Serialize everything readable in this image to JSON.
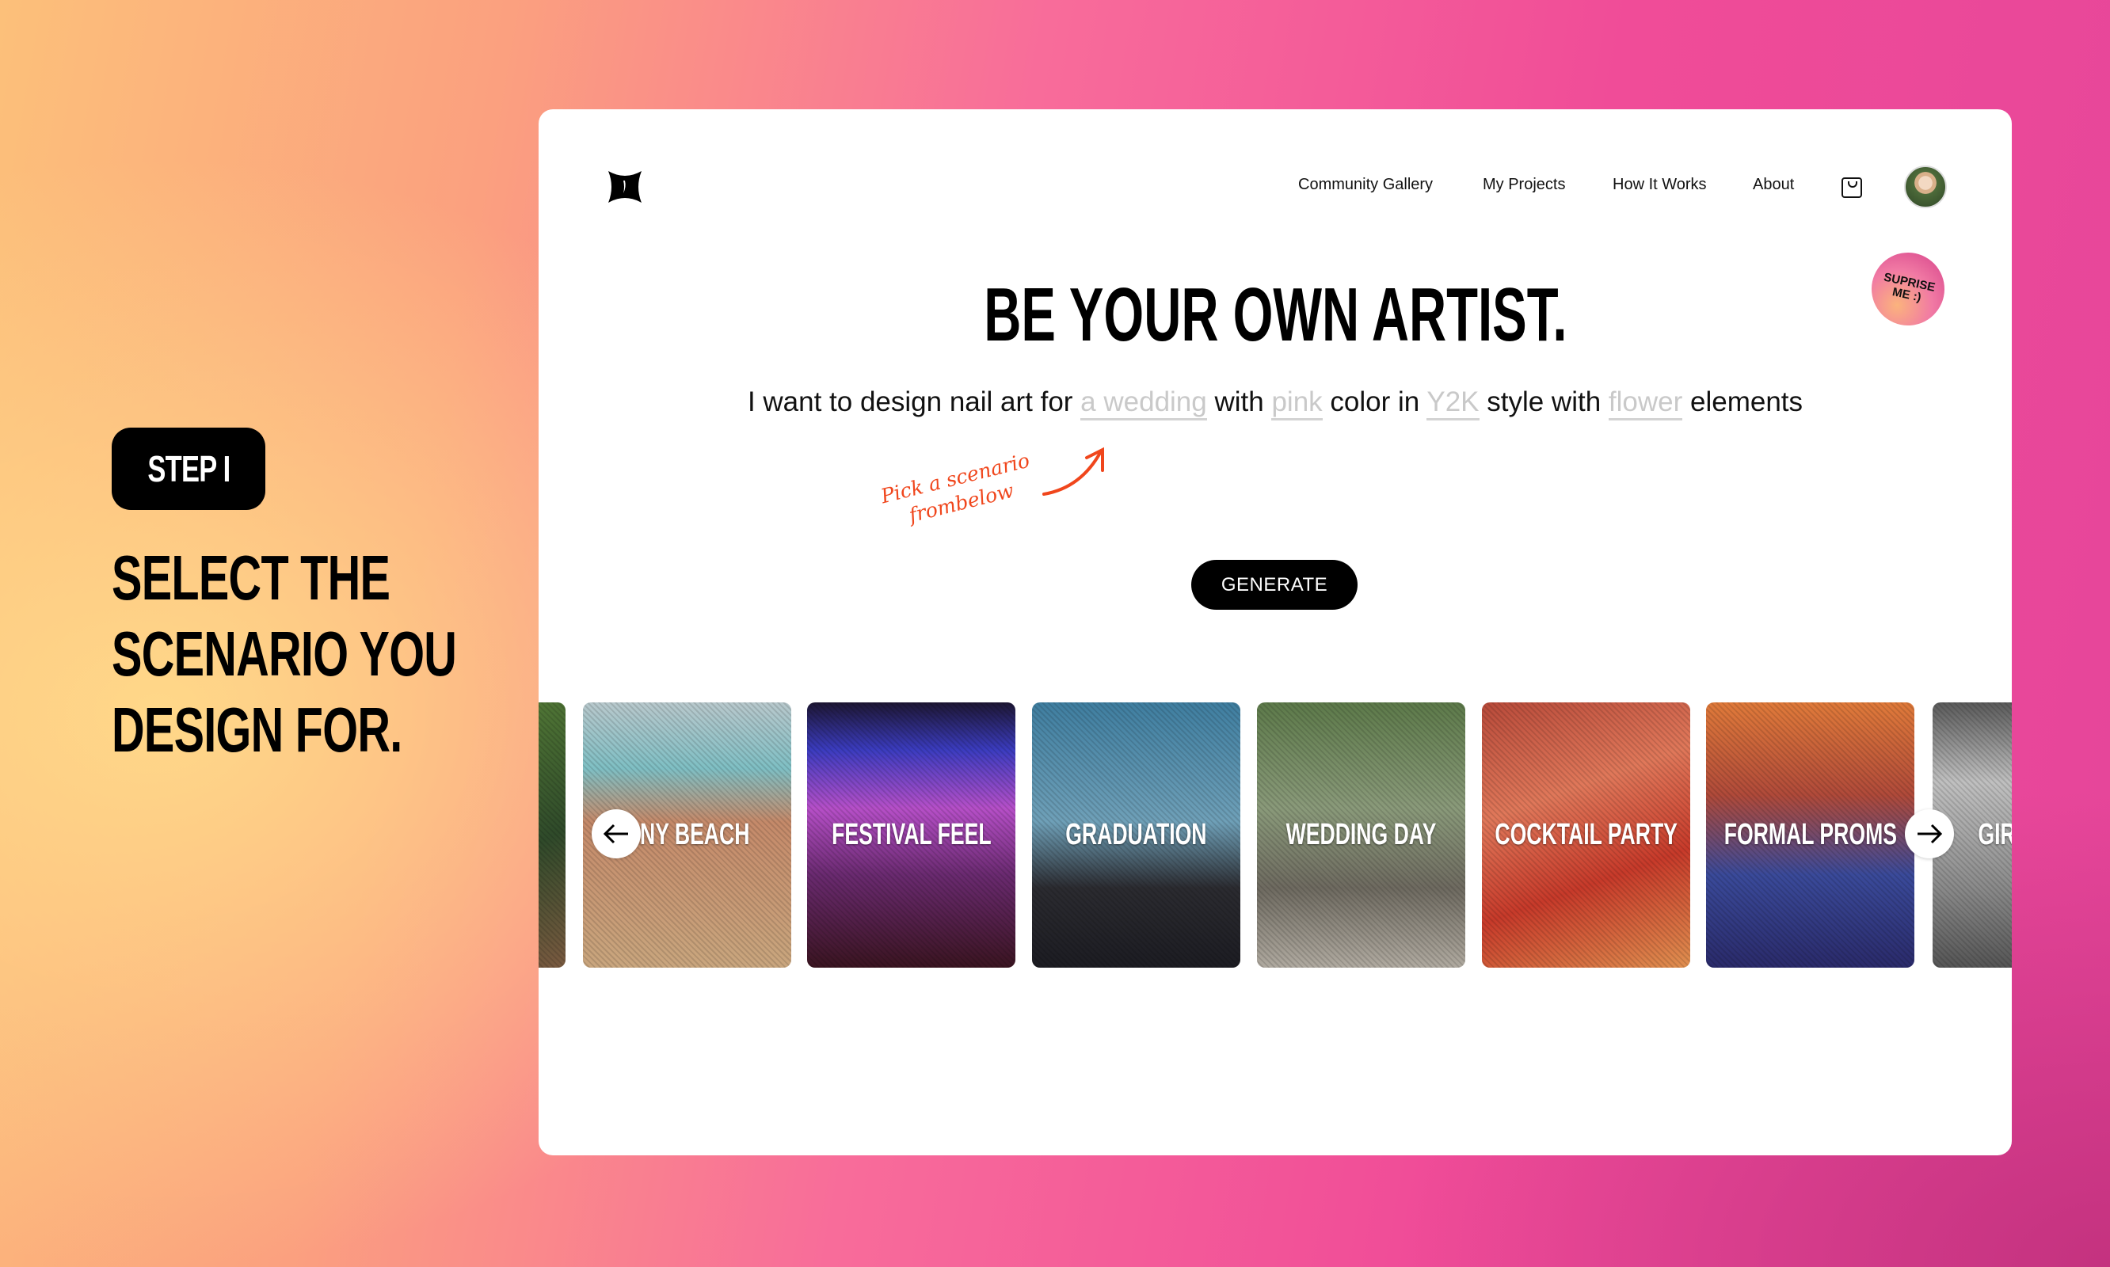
{
  "left_panel": {
    "step_label": "STEP I",
    "heading_lines": [
      "SELECT THE",
      "SCENARIO YOU",
      "DESIGN FOR."
    ]
  },
  "nav": {
    "items": [
      "Community Gallery",
      "My Projects",
      "How It Works",
      "About"
    ],
    "cart_icon": "shopping-bag-icon",
    "avatar": "user-avatar"
  },
  "surprise": {
    "label_line1": "SUPRISE",
    "label_line2": "ME :)"
  },
  "hero": {
    "headline": "BE YOUR OWN ARTIST.",
    "sentence": {
      "p1": "I want to design nail art for",
      "slot1": "a wedding",
      "p2": "with",
      "slot2": "pink",
      "p3": "color in",
      "slot3": "Y2K",
      "p4": "style with",
      "slot4": "flower",
      "p5": "elements"
    },
    "annotation_line1": "Pick a scenario",
    "annotation_line2": "frombelow",
    "generate_label": "GENERATE"
  },
  "scenarios": [
    "NNY BEACH",
    "FESTIVAL FEEL",
    "GRADUATION",
    "WEDDING DAY",
    "COCKTAIL PARTY",
    "FORMAL PROMS",
    "GIRLS"
  ],
  "colors": {
    "accent": "#f0461c",
    "slot_text": "#c9c9c9",
    "button": "#000000"
  }
}
